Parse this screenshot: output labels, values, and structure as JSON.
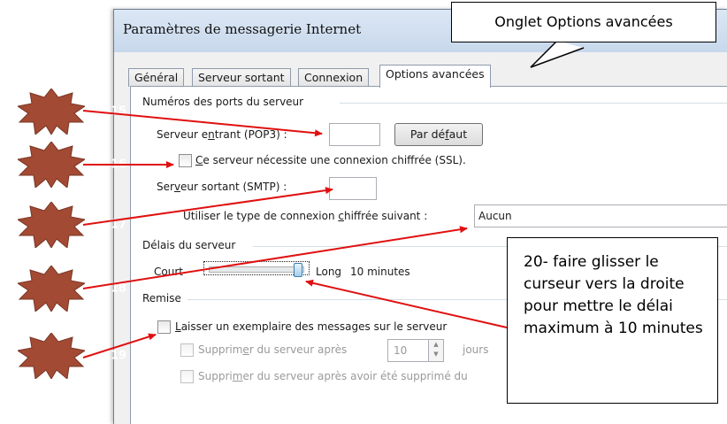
{
  "window": {
    "title": "Paramètres de messagerie Internet"
  },
  "tabs": [
    {
      "label": "Général"
    },
    {
      "label": "Serveur sortant"
    },
    {
      "label": "Connexion"
    },
    {
      "label": "Options avancées"
    }
  ],
  "ports": {
    "group_title": "Numéros des ports du serveur",
    "incoming_label_pre": "Serveur e",
    "incoming_label_u": "n",
    "incoming_label_post": "trant (POP3) :",
    "incoming_value": "",
    "default_button_pre": "Par dé",
    "default_button_u": "f",
    "default_button_post": "aut",
    "ssl_checkbox_u": "C",
    "ssl_checkbox_rest": "e serveur nécessite une connexion chiffrée (SSL).",
    "ssl_checked": false,
    "outgoing_label_pre": "Ser",
    "outgoing_label_u": "v",
    "outgoing_label_post": "eur sortant (SMTP) :",
    "outgoing_value": "",
    "encryption_label_pre": "Utiliser le type de connexion ",
    "encryption_label_u": "c",
    "encryption_label_post": "hiffrée suivant :",
    "encryption_value": "Aucun"
  },
  "timeout": {
    "group_title": "Délais du serveur",
    "short_label": "Court",
    "long_label": "Long",
    "value_text": "10 minutes",
    "slider_level": 1.0
  },
  "delivery": {
    "group_title": "Remise",
    "keep_copy_u": "L",
    "keep_copy_rest": "aisser un exemplaire des messages sur le serveur",
    "keep_copy_checked": false,
    "remove_after_pre": "Supprim",
    "remove_after_u": "e",
    "remove_after_post": "r du serveur après",
    "remove_after_value": "10",
    "days_label": "jours",
    "remove_deleted_pre": "Suppri",
    "remove_deleted_u": "m",
    "remove_deleted_post": "er du serveur après avoir été supprimé du"
  },
  "callouts": {
    "tab_note": "Onglet Options avancées",
    "slider_note": "20- faire glisser le curseur vers la droite pour mettre le délai maximum à 10 minutes"
  },
  "badges": [
    "15",
    "16",
    "17",
    "18",
    "19"
  ],
  "colors": {
    "badge": "#a24a33",
    "arrow": "#e01010"
  }
}
